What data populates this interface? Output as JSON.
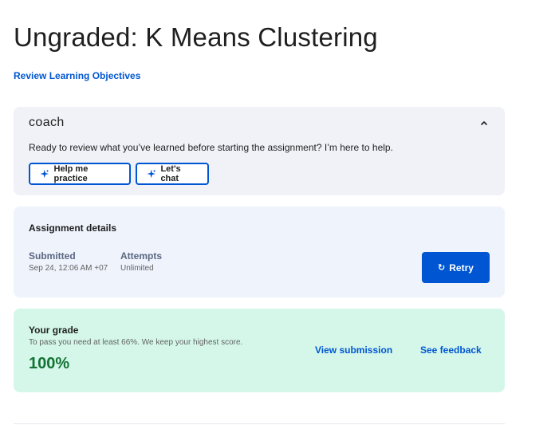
{
  "page": {
    "title": "Ungraded: K Means Clustering",
    "objectives_link": "Review Learning Objectives"
  },
  "coach": {
    "logo_text": "coach",
    "message": "Ready to review what you’ve learned before starting the assignment? I’m here to help.",
    "buttons": [
      {
        "label": "Help me practice",
        "icon": "sparkle-icon"
      },
      {
        "label": "Let's chat",
        "icon": "sparkle-icon"
      }
    ],
    "collapse_icon": "chevron-up-icon"
  },
  "assignment": {
    "heading": "Assignment details",
    "submitted_label": "Submitted",
    "submitted_value": "Sep 24, 12:06 AM +07",
    "attempts_label": "Attempts",
    "attempts_value": "Unlimited",
    "retry_label": "Retry",
    "retry_icon": "refresh-icon"
  },
  "grade": {
    "heading": "Your grade",
    "note": "To pass you need at least 66%. We keep your highest score.",
    "value": "100%",
    "view_submission": "View submission",
    "see_feedback": "See feedback"
  },
  "colors": {
    "accent": "#0056d2",
    "coach_bg": "#f0f2f7",
    "details_bg": "#eef3fc",
    "grade_bg": "#d4f7ea",
    "grade_text": "#137333"
  }
}
